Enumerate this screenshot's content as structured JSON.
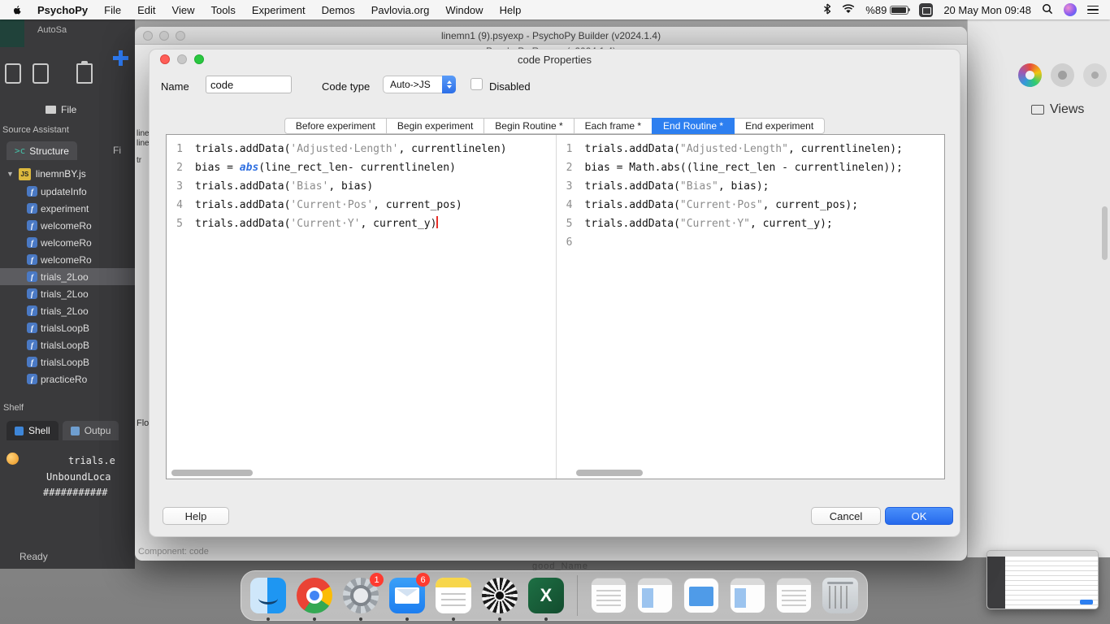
{
  "menubar": {
    "app_name": "PsychoPy",
    "menus": [
      "File",
      "Edit",
      "View",
      "Tools",
      "Experiment",
      "Demos",
      "Pavlovia.org",
      "Window",
      "Help"
    ],
    "status": {
      "battery_percent": "%89",
      "clock": "20 May Mon 09:48"
    }
  },
  "builder": {
    "title": "linemn1 (9).psyexp - PsychoPy Builder (v2024.1.4)",
    "runner_title": "PsychoPy Runner (v2024.1.4)",
    "component_label": "Component: code",
    "routine_fragment_1": "line Rou",
    "routine_fragment_2": "line",
    "routine_fragment_3": "tr",
    "flow_fragment": "Flo"
  },
  "dialog": {
    "title": "code Properties",
    "name_label": "Name",
    "name_value": "code",
    "code_type_label": "Code type",
    "code_type_value": "Auto->JS",
    "disabled_label": "Disabled",
    "tabs": [
      "Before experiment",
      "Begin experiment",
      "Begin Routine *",
      "Each frame *",
      "End Routine *",
      "End experiment"
    ],
    "active_tab": "End Routine *",
    "buttons": {
      "help": "Help",
      "cancel": "Cancel",
      "ok": "OK"
    }
  },
  "editor": {
    "left": {
      "lines": [
        [
          {
            "t": "trials.addData("
          },
          {
            "t": "'Adjusted·Length'",
            "c": "s"
          },
          {
            "t": ", currentlinelen)"
          }
        ],
        [
          {
            "t": "bias = "
          },
          {
            "t": "abs",
            "c": "k"
          },
          {
            "t": "(line_rect_len- currentlinelen)"
          }
        ],
        [
          {
            "t": "trials.addData("
          },
          {
            "t": "'Bias'",
            "c": "s"
          },
          {
            "t": ", bias)"
          }
        ],
        [
          {
            "t": "trials.addData("
          },
          {
            "t": "'Current·Pos'",
            "c": "s"
          },
          {
            "t": ", current_pos)"
          }
        ],
        [
          {
            "t": "trials.addData("
          },
          {
            "t": "'Current·Y'",
            "c": "s"
          },
          {
            "t": ", current_y)",
            "caret": true
          }
        ]
      ]
    },
    "right": {
      "lines": [
        [
          {
            "t": "trials.addData("
          },
          {
            "t": "\"Adjusted·Length\"",
            "c": "s"
          },
          {
            "t": ", currentlinelen);"
          }
        ],
        [
          {
            "t": "bias = Math.abs((line_rect_len - currentlinelen));"
          }
        ],
        [
          {
            "t": "trials.addData("
          },
          {
            "t": "\"Bias\"",
            "c": "s"
          },
          {
            "t": ", bias);"
          }
        ],
        [
          {
            "t": "trials.addData("
          },
          {
            "t": "\"Current·Pos\"",
            "c": "s"
          },
          {
            "t": ", current_pos);"
          }
        ],
        [
          {
            "t": "trials.addData("
          },
          {
            "t": "\"Current·Y\"",
            "c": "s"
          },
          {
            "t": ", current_y);"
          }
        ],
        []
      ]
    }
  },
  "side_app": {
    "autosave_fragment": "AutoSa",
    "file_label": "File",
    "panel_title": "Source Assistant",
    "tab_structure_icon": ">c",
    "tab_structure": "Structure",
    "tab_file_partial": "Fi",
    "tree_root": "linemnBY.js",
    "tree_badge": "JS",
    "tree_caret": "▼",
    "tree_items": [
      "updateInfo",
      "experiment",
      "welcomeRo",
      "welcomeRo",
      "welcomeRo",
      "trials_2Loo",
      "trials_2Loo",
      "trials_2Loo",
      "trialsLoopB",
      "trialsLoopB",
      "trialsLoopB",
      "practiceRo"
    ],
    "selected_index": 5,
    "shelf_label": "Shelf",
    "tab_shell": "Shell",
    "tab_output": "Outpu",
    "console_lines": [
      "trials.e",
      "UnboundLoca",
      "###########"
    ],
    "status": "Ready"
  },
  "right_panel": {
    "views_label": "Views"
  },
  "desktop": {
    "fragment": "good_Name"
  },
  "colors": {
    "accent_blue": "#2d7ff0",
    "tab_active": "#2d7ff0",
    "string_gray": "#8c8c8c",
    "keyword_blue": "#2f6fe0"
  },
  "dock": {
    "items": [
      {
        "name": "finder",
        "type": "finder",
        "dot": true
      },
      {
        "name": "chrome",
        "type": "chrome",
        "dot": true
      },
      {
        "name": "system-preferences",
        "type": "gear",
        "badge": "1",
        "dot": true
      },
      {
        "name": "mail",
        "type": "mail",
        "badge": "6",
        "dot": true
      },
      {
        "name": "notes",
        "type": "notes",
        "dot": true
      },
      {
        "name": "disc",
        "type": "disc",
        "dot": true
      },
      {
        "name": "excel",
        "type": "excel",
        "glyph": "X",
        "dot": true
      },
      {
        "sep": true
      },
      {
        "name": "document-1",
        "type": "doc"
      },
      {
        "name": "document-2",
        "type": "doc2"
      },
      {
        "name": "document-3",
        "type": "doc3"
      },
      {
        "name": "document-4",
        "type": "doc2"
      },
      {
        "name": "document-5",
        "type": "doc"
      },
      {
        "name": "trash",
        "type": "trash"
      }
    ]
  }
}
